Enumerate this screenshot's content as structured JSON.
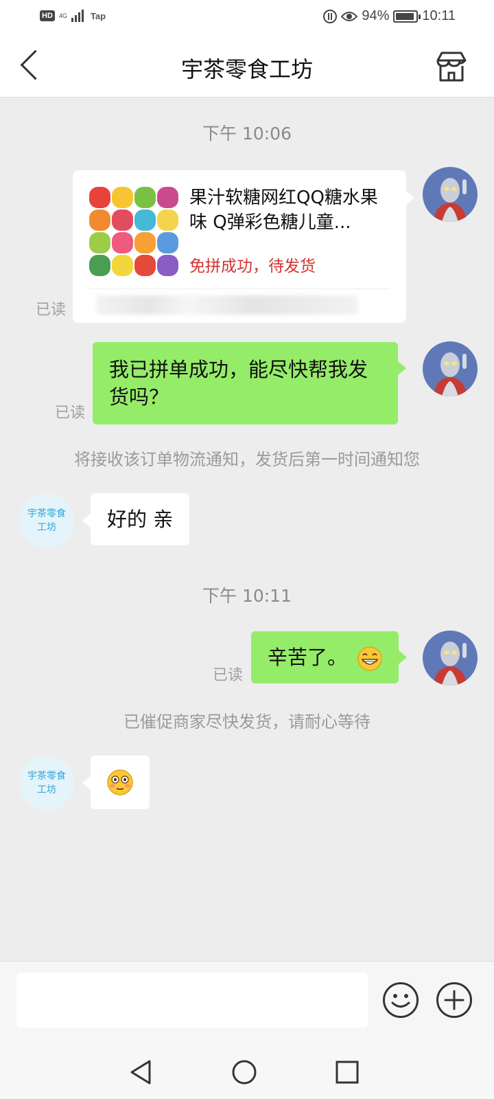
{
  "status_bar": {
    "hd": "HD",
    "network": "4G",
    "carrier_extra": "Tap",
    "battery_percent": "94%",
    "battery_level": 0.94,
    "time": "10:11"
  },
  "nav": {
    "title": "宇茶零食工坊",
    "back_icon": "chevron-left-icon",
    "store_icon": "storefront-icon"
  },
  "chat": {
    "timestamp_1": "下午 10:06",
    "product_card": {
      "title": "果汁软糖网红QQ糖水果味 Q弹彩色糖儿童...",
      "status": "免拼成功，待发货",
      "read": "已读"
    },
    "message_1": {
      "text": "我已拼单成功，能尽快帮我发货吗？",
      "read": "已读"
    },
    "notice_1": "将接收该订单物流通知，发货后第一时间通知您",
    "shop_avatar_text": "宇茶零食工坊",
    "reply_1": "好的  亲",
    "timestamp_2": "下午 10:11",
    "message_2": {
      "text": "辛苦了。",
      "emoji": "grinning-face-icon",
      "read": "已读"
    },
    "notice_2": "已催促商家尽快发货，请耐心等待",
    "reply_2_emoji": "flushed-face-icon"
  },
  "input": {
    "placeholder": "",
    "emoji_icon": "smiley-icon",
    "plus_icon": "plus-circle-icon"
  },
  "system_nav": {
    "back": "triangle-back-icon",
    "home": "circle-home-icon",
    "recents": "square-recents-icon"
  }
}
